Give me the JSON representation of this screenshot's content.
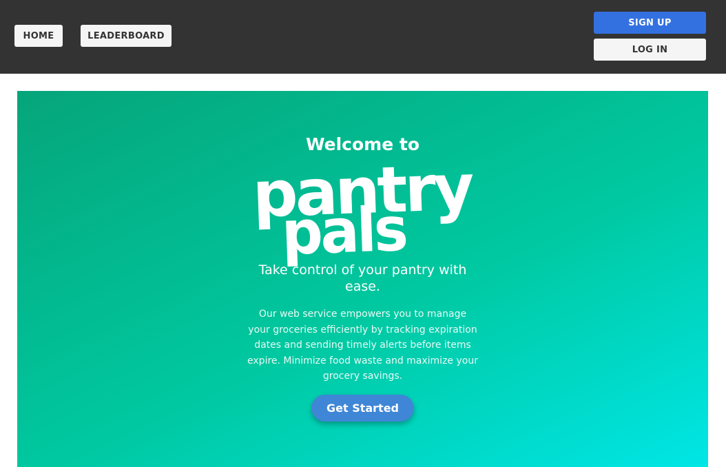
{
  "nav": {
    "home_label": "HOME",
    "leaderboard_label": "LEADERBOARD"
  },
  "auth": {
    "signup_label": "SIGN UP",
    "login_label": "LOG IN"
  },
  "hero": {
    "welcome": "Welcome to",
    "logo_line1": "pantry",
    "logo_line2": "pals",
    "tagline": "Take control of your pantry with ease.",
    "description": "Our web service empowers you to manage your groceries efficiently by tracking expiration dates and sending timely alerts before items expire. Minimize food waste and maximize your grocery savings.",
    "cta_label": "Get Started"
  },
  "colors": {
    "topbar": "#333333",
    "signup": "#3471e0",
    "hero_start": "#06a57a",
    "hero_end": "#00e6e6",
    "cta": "#3f86d6"
  }
}
